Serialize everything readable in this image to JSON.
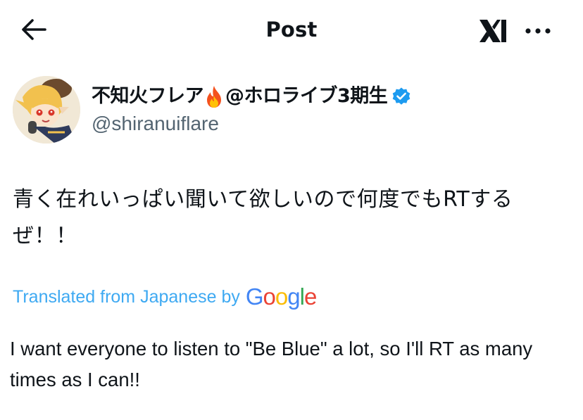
{
  "header": {
    "title": "Post",
    "back_icon": "arrow-left-icon",
    "grok_icon": "grok-icon",
    "more_icon": "more-horizontal-icon"
  },
  "author": {
    "display_name": "不知火フレア",
    "display_suffix": "@ホロライブ3期生",
    "handle": "@shiranuiflare",
    "verified": true,
    "emoji_icon": "fire-icon",
    "verified_color": "#1d9bf0"
  },
  "post": {
    "text": "青く在れいっぱい聞いて欲しいので何度でもRTするぜ！！"
  },
  "translation": {
    "label": "Translated from Japanese by",
    "provider_letters": [
      "G",
      "o",
      "o",
      "g",
      "l",
      "e"
    ],
    "provider_colors": [
      "#4285F4",
      "#EA4335",
      "#FBBC05",
      "#4285F4",
      "#34A853",
      "#EA4335"
    ],
    "text": "I want everyone to listen to \"Be Blue\" a lot, so I'll RT as many times as I can!!"
  },
  "colors": {
    "text_primary": "#0f1419",
    "text_secondary": "#536471",
    "accent": "#1d9bf0"
  }
}
